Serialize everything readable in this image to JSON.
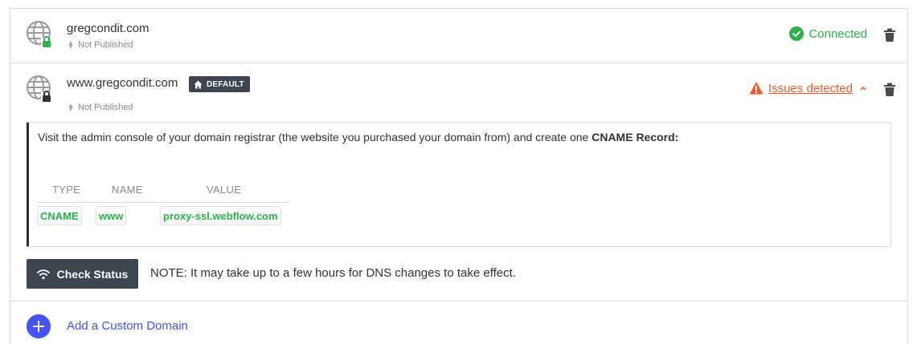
{
  "colors": {
    "connected": "#2bb24c",
    "issues": "#ee5b2b",
    "accent": "#4353ff",
    "dark": "#3d4650",
    "record_value": "#2bb24c"
  },
  "domains": [
    {
      "name": "gregcondit.com",
      "publish_status": "Not Published",
      "status_label": "Connected",
      "status_icon": "check-circle-icon",
      "lock_icon": "lock-green"
    },
    {
      "name": "www.gregcondit.com",
      "badge": "DEFAULT",
      "publish_status": "Not Published",
      "status_label": "Issues detected",
      "status_icon": "warning-icon",
      "lock_icon": "lock-dark"
    }
  ],
  "instructions": {
    "text": "Visit the admin console of your domain registrar (the website you purchased your domain from) and create one ",
    "emphasis": "CNAME Record:",
    "table": {
      "headers": [
        "TYPE",
        "NAME",
        "VALUE"
      ],
      "row": [
        "CNAME",
        "www",
        "proxy-ssl.webflow.com"
      ]
    }
  },
  "check_status": {
    "button_label": "Check Status",
    "note": "NOTE: It may take up to a few hours for DNS changes to take effect."
  },
  "add_domain": {
    "label": "Add a Custom Domain"
  }
}
